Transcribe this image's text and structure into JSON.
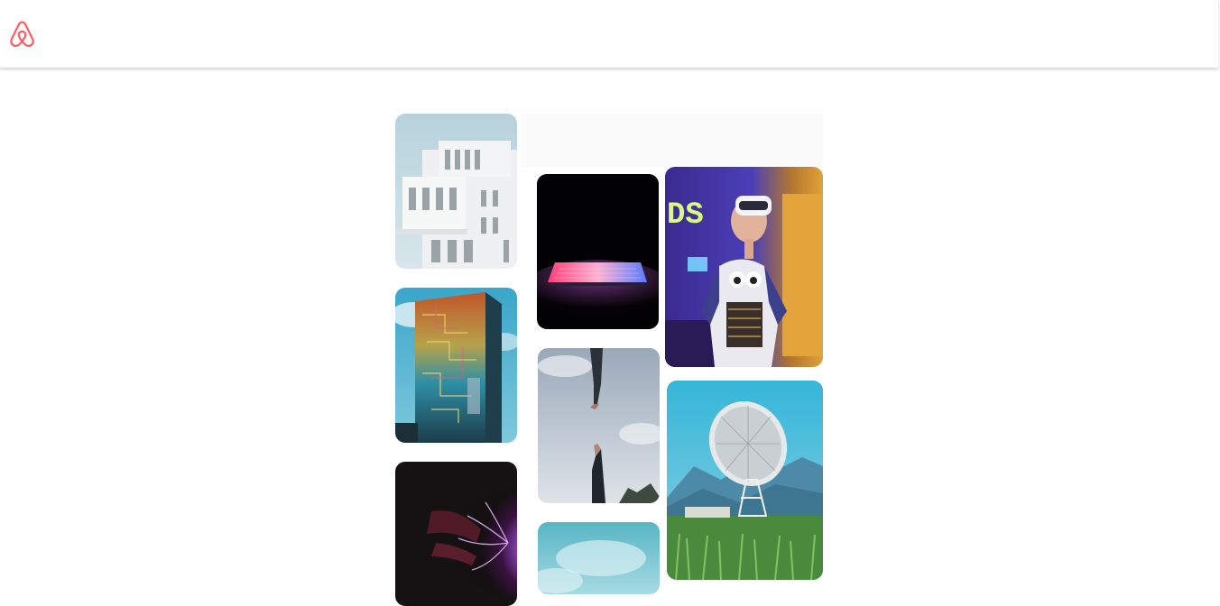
{
  "brand": {
    "name": "airbnb",
    "color": "#FF5A5F"
  },
  "header": {
    "logo_icon": "airbnb-belo-icon"
  },
  "gallery": {
    "tiles": [
      {
        "subject": "white-modern-building-photo"
      },
      {
        "subject": "dark-laptop-neon-light-photo"
      },
      {
        "subject": "person-vr-headset-photo"
      },
      {
        "subject": "graffiti-circuit-building-photo"
      },
      {
        "subject": "hands-reaching-sky-photo"
      },
      {
        "subject": "radio-telescope-dish-photo"
      },
      {
        "subject": "plasma-ball-hand-photo"
      },
      {
        "subject": "cloudy-blue-sky-photo"
      }
    ]
  }
}
